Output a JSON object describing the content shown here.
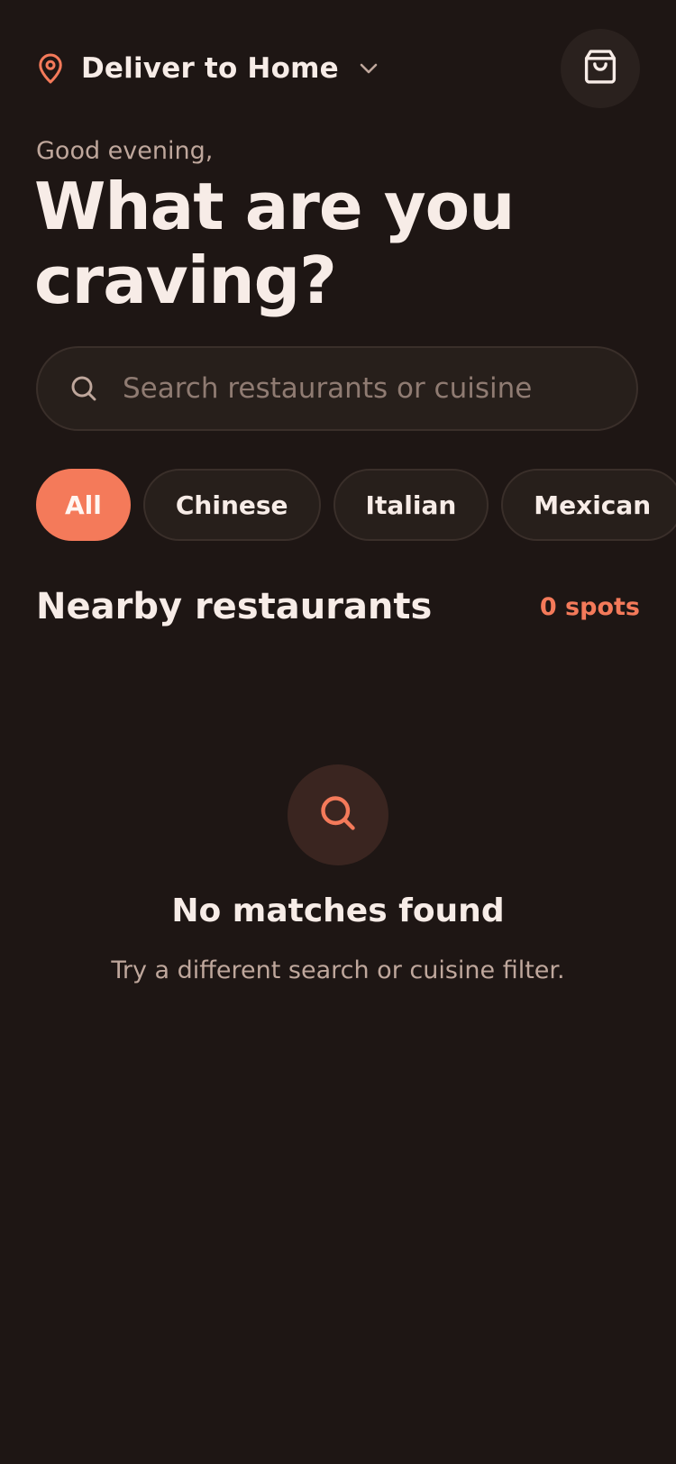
{
  "header": {
    "location_label": "Deliver to Home",
    "location_icon": "map-pin-icon",
    "dropdown_icon": "chevron-down-icon",
    "cart_icon": "shopping-bag-icon"
  },
  "greeting": "Good evening,",
  "headline": "What are you craving?",
  "search": {
    "placeholder": "Search restaurants or cuisine",
    "value": "",
    "icon": "search-icon"
  },
  "filters": {
    "selected": "All",
    "items": [
      {
        "label": "All"
      },
      {
        "label": "Chinese"
      },
      {
        "label": "Italian"
      },
      {
        "label": "Mexican"
      },
      {
        "label": ""
      }
    ]
  },
  "section": {
    "title": "Nearby restaurants",
    "count_label": "0 spots"
  },
  "empty_state": {
    "icon": "search-icon",
    "title": "No matches found",
    "subtitle": "Try a different search or cuisine filter."
  },
  "colors": {
    "background": "#1e1614",
    "accent": "#f47a5a",
    "surface": "#271f1b",
    "text_primary": "#f7ece7",
    "text_muted": "#bfa79c"
  }
}
